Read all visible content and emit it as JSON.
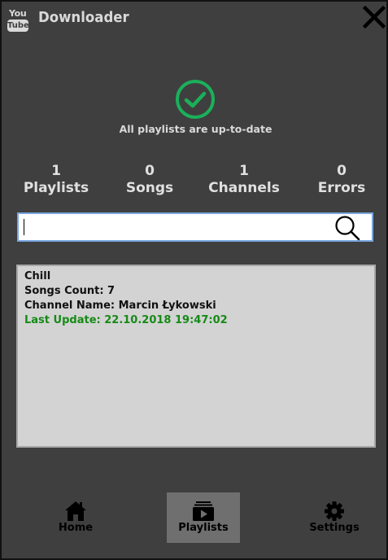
{
  "header": {
    "logo_top": "You",
    "logo_bottom": "Tube",
    "title": "Downloader"
  },
  "status": {
    "text": "All playlists are up-to-date",
    "color": "#1ab05a"
  },
  "stats": [
    {
      "value": "1",
      "label": "Playlists"
    },
    {
      "value": "0",
      "label": "Songs"
    },
    {
      "value": "1",
      "label": "Channels"
    },
    {
      "value": "0",
      "label": "Errors"
    }
  ],
  "search": {
    "value": "",
    "placeholder": ""
  },
  "playlists": [
    {
      "name": "Chill",
      "songs_count": "Songs Count: 7",
      "channel": "Channel Name: Marcin Łykowski",
      "last_update": "Last Update: 22.10.2018 19:47:02"
    }
  ],
  "nav": {
    "home": "Home",
    "playlists": "Playlists",
    "settings": "Settings",
    "active": "playlists"
  },
  "icons": [
    "youtube-logo-icon",
    "close-icon",
    "check-circle-icon",
    "search-icon",
    "home-icon",
    "playlist-icon",
    "gear-icon"
  ]
}
